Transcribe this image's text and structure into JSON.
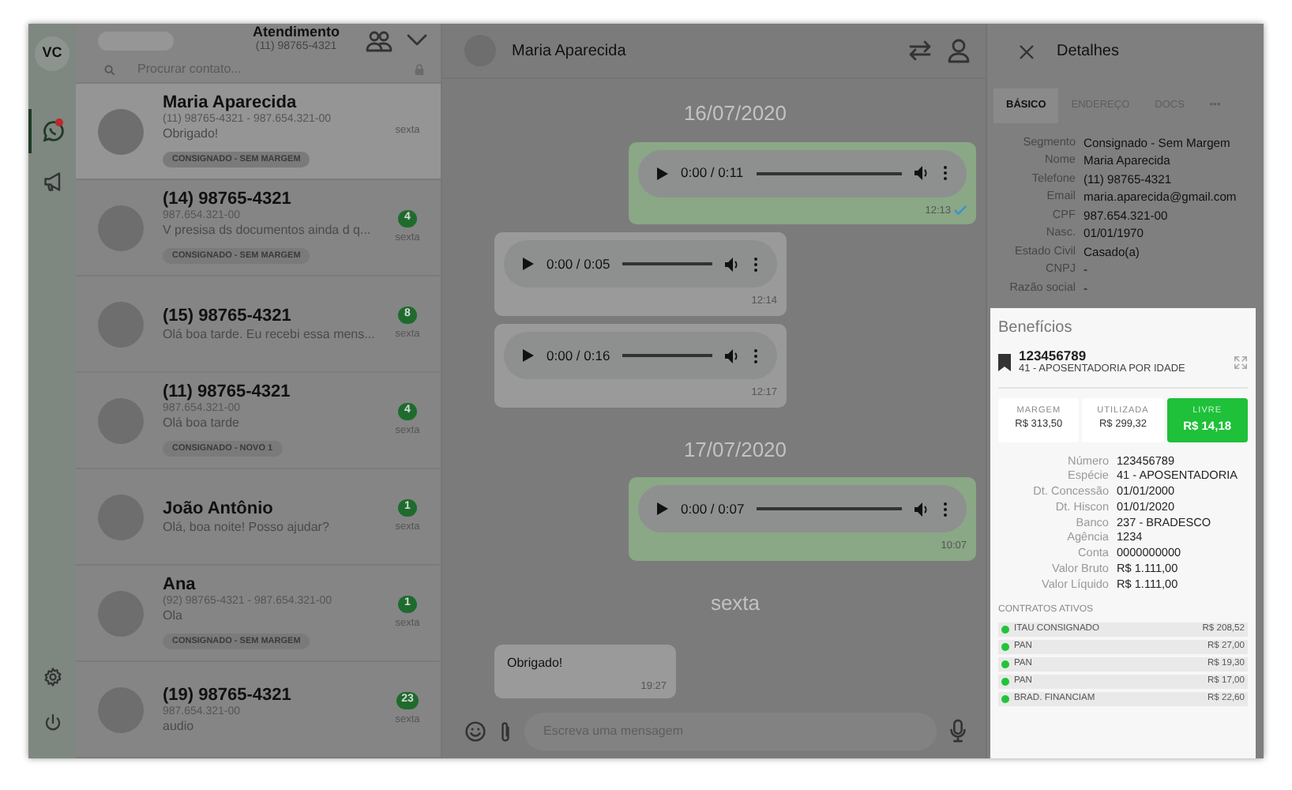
{
  "sidebar": {
    "initials": "VC",
    "nav": [
      {
        "kind": "chat",
        "selected": true,
        "notification": true
      },
      {
        "kind": "megaphone",
        "selected": false,
        "notification": false
      }
    ]
  },
  "list_header": {
    "title": "Atendimento",
    "phone": "(11) 98765-4321"
  },
  "search": {
    "placeholder": "Procurar contato..."
  },
  "contacts": [
    {
      "name": "Maria Aparecida",
      "subtitle": "(11) 98765-4321 - 987.654.321-00",
      "message": "Obrigado!",
      "tag": "CONSIGNADO - SEM MARGEM",
      "time": "sexta",
      "selected": true
    },
    {
      "name": "(14) 98765-4321",
      "subtitle": "987.654.321-00",
      "message": "V presisa ds documentos ainda d q...",
      "tag": "CONSIGNADO - SEM MARGEM",
      "unread": "4",
      "time": "sexta",
      "selected": false
    },
    {
      "name": "(15) 98765-4321",
      "message": "Olá boa tarde. Eu recebi essa mens...",
      "unread": "8",
      "time": "sexta",
      "selected": false
    },
    {
      "name": "(11) 98765-4321",
      "subtitle": "987.654.321-00",
      "message": "Olá boa tarde",
      "tag": "CONSIGNADO - NOVO 1",
      "unread": "4",
      "time": "sexta",
      "selected": false
    },
    {
      "name": "João Antônio",
      "message": "Olá, boa noite! Posso ajudar?",
      "unread": "1",
      "time": "sexta",
      "selected": false
    },
    {
      "name": "Ana",
      "subtitle": "(92) 98765-4321 - 987.654.321-00",
      "message": "Ola",
      "tag": "CONSIGNADO - SEM MARGEM",
      "unread": "1",
      "time": "sexta",
      "selected": false
    },
    {
      "name": "(19) 98765-4321",
      "subtitle": "987.654.321-00",
      "message": "audio",
      "unread": "23",
      "time": "sexta",
      "selected": false
    }
  ],
  "chat": {
    "name": "Maria Aparecida",
    "messages": [
      {
        "kind": "date",
        "text": "16/07/2020"
      },
      {
        "kind": "audio",
        "outgoing": true,
        "duration": "0:00 / 0:11",
        "time": "12:13",
        "read": true
      },
      {
        "kind": "audio",
        "outgoing": false,
        "duration": "0:00 / 0:05",
        "time": "12:14",
        "read": false
      },
      {
        "kind": "audio",
        "outgoing": false,
        "duration": "0:00 / 0:16",
        "time": "12:17",
        "read": false
      },
      {
        "kind": "date",
        "text": "17/07/2020"
      },
      {
        "kind": "audio",
        "outgoing": true,
        "duration": "0:00 / 0:07",
        "time": "10:07",
        "read": false
      },
      {
        "kind": "date",
        "text": "sexta"
      },
      {
        "kind": "text",
        "outgoing": false,
        "text": "Obrigado!",
        "time": "19:27"
      }
    ],
    "composer": {
      "placeholder": "Escreva uma mensagem"
    }
  },
  "details": {
    "title": "Detalhes",
    "tabs": [
      {
        "label": "BÁSICO",
        "selected": true
      },
      {
        "label": "ENDEREÇO",
        "selected": false
      },
      {
        "label": "DOCS",
        "selected": false
      },
      {
        "label": "•••",
        "selected": false
      }
    ],
    "fields": [
      {
        "label": "Segmento",
        "value": "Consignado - Sem Margem"
      },
      {
        "label": "Nome",
        "value": "Maria Aparecida"
      },
      {
        "label": "Telefone",
        "value": "(11) 98765-4321"
      },
      {
        "label": "Email",
        "value": "maria.aparecida@gmail.com"
      },
      {
        "label": "CPF",
        "value": "987.654.321-00"
      },
      {
        "label": "Nasc.",
        "value": "01/01/1970"
      },
      {
        "label": "Estado Civil",
        "value": "Casado(a)"
      },
      {
        "label": "CNPJ",
        "value": "-"
      },
      {
        "label": "Razão social",
        "value": "-"
      }
    ]
  },
  "benefits": {
    "title": "Benefícios",
    "number": "123456789",
    "description": "41 - APOSENTADORIA POR IDADE",
    "summary": [
      {
        "label": "MARGEM",
        "value": "R$ 313,50",
        "selected": false
      },
      {
        "label": "UTILIZADA",
        "value": "R$ 299,32",
        "selected": false
      },
      {
        "label": "LIVRE",
        "value": "R$ 14,18",
        "selected": true
      }
    ],
    "fields": [
      {
        "label": "Número",
        "value": "123456789"
      },
      {
        "label": "Espécie",
        "value": "41 - APOSENTADORIA"
      },
      {
        "label": "Dt. Concessão",
        "value": "01/01/2000"
      },
      {
        "label": "Dt. Hiscon",
        "value": "01/01/2020"
      },
      {
        "label": "Banco",
        "value": "237 - BRADESCO"
      },
      {
        "label": "Agência",
        "value": "1234"
      },
      {
        "label": "Conta",
        "value": "0000000000"
      },
      {
        "label": "Valor Bruto",
        "value": "R$ 1.111,00"
      },
      {
        "label": "Valor Líquido",
        "value": "R$ 1.111,00"
      }
    ],
    "contracts_title": "CONTRATOS ATIVOS",
    "contracts": [
      {
        "name": "ITAU CONSIGNADO",
        "amount": "R$ 208,52",
        "color": "#22c33a"
      },
      {
        "name": "PAN",
        "amount": "R$ 27,00",
        "color": "#22c33a"
      },
      {
        "name": "PAN",
        "amount": "R$ 19,30",
        "color": "#22c33a"
      },
      {
        "name": "PAN",
        "amount": "R$ 17,00",
        "color": "#22c33a"
      },
      {
        "name": "BRAD. FINANCIAM",
        "amount": "R$ 22,60",
        "color": "#22c33a"
      }
    ]
  }
}
